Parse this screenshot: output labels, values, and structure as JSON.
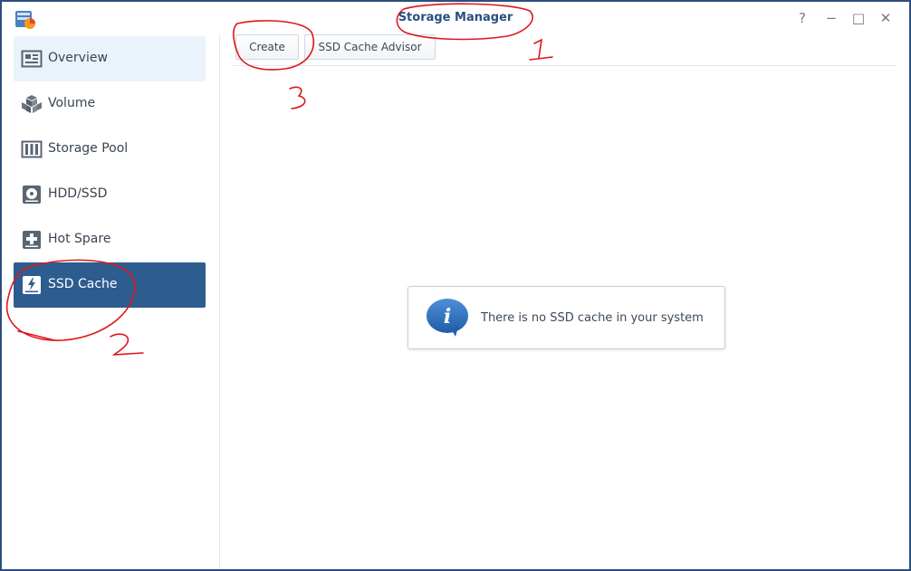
{
  "window": {
    "title": "Storage Manager",
    "controls": {
      "help": "?",
      "minimize": "−",
      "maximize": "□",
      "close": "✕"
    }
  },
  "sidebar": {
    "items": [
      {
        "label": "Overview",
        "icon": "overview-icon",
        "state": "hover"
      },
      {
        "label": "Volume",
        "icon": "volume-icon",
        "state": "normal"
      },
      {
        "label": "Storage Pool",
        "icon": "storage-pool-icon",
        "state": "normal"
      },
      {
        "label": "HDD/SSD",
        "icon": "hdd-icon",
        "state": "normal"
      },
      {
        "label": "Hot Spare",
        "icon": "hot-spare-icon",
        "state": "normal"
      },
      {
        "label": "SSD Cache",
        "icon": "ssd-cache-icon",
        "state": "active"
      }
    ]
  },
  "toolbar": {
    "create_label": "Create",
    "advisor_label": "SSD Cache Advisor"
  },
  "empty_state": {
    "icon": "info-icon",
    "message": "There is no SSD cache in your system"
  },
  "colors": {
    "accent": "#2d5c8f",
    "annotation": "#e0151b",
    "hover": "#eaf3fc"
  }
}
